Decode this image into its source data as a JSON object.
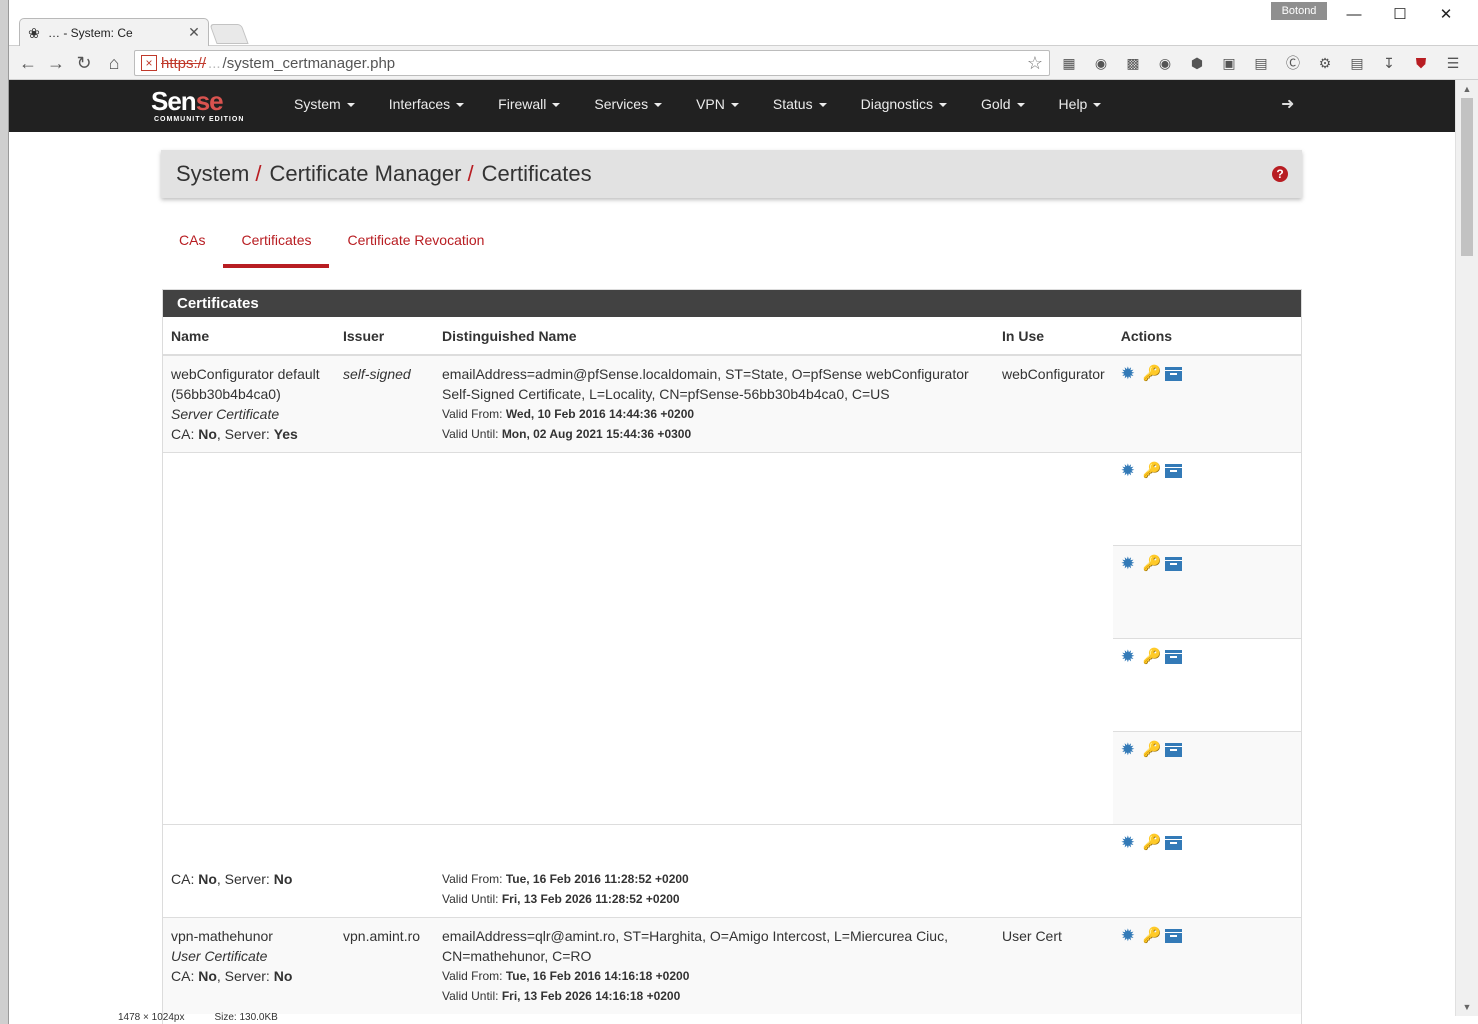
{
  "browser": {
    "tab_title": "… - System: Ce",
    "user_badge": "Botond",
    "url_scheme": "https://",
    "url_host": "...",
    "url_path": "/system_certmanager.php",
    "window_controls": [
      "—",
      "☐",
      "✕"
    ]
  },
  "nav": {
    "logo_text_a": "Sen",
    "logo_text_b": "se",
    "logo_sub": "COMMUNITY EDITION",
    "items": [
      "System",
      "Interfaces",
      "Firewall",
      "Services",
      "VPN",
      "Status",
      "Diagnostics",
      "Gold",
      "Help"
    ]
  },
  "breadcrumb": {
    "parts": [
      "System",
      "Certificate Manager",
      "Certificates"
    ],
    "separator": "/"
  },
  "tabs": [
    "CAs",
    "Certificates",
    "Certificate Revocation"
  ],
  "active_tab": "Certificates",
  "panel": {
    "title": "Certificates",
    "columns": [
      "Name",
      "Issuer",
      "Distinguished Name",
      "In Use",
      "Actions"
    ]
  },
  "rows": [
    {
      "name": "webConfigurator default (56bb30b4b4ca0)",
      "type": "Server Certificate",
      "ca_label": "CA:",
      "ca": "No",
      "server_label": ", Server:",
      "server": "Yes",
      "issuer": "self-signed",
      "dn": "emailAddress=admin@pfSense.localdomain, ST=State, O=pfSense webConfigurator Self-Signed Certificate, L=Locality, CN=pfSense-56bb30b4b4ca0, C=US",
      "valid_from_label": "Valid From:",
      "valid_from": "Wed, 10 Feb 2016 14:44:36 +0200",
      "valid_until_label": "Valid Until:",
      "valid_until": "Mon, 02 Aug 2021 15:44:36 +0300",
      "in_use": "webConfigurator"
    },
    {
      "ca_label": "CA:",
      "ca": "No",
      "server_label": ", Server:",
      "server": "No",
      "valid_from_label": "Valid From:",
      "valid_from": "Tue, 16 Feb 2016 11:28:52 +0200",
      "valid_until_label": "Valid Until:",
      "valid_until": "Fri, 13 Feb 2026 11:28:52 +0200"
    },
    {
      "name": "vpn-mathehunor",
      "type": "User Certificate",
      "ca_label": "CA:",
      "ca": "No",
      "server_label": ", Server:",
      "server": "No",
      "issuer": "vpn.amint.ro",
      "dn": "emailAddress=qlr@amint.ro, ST=Harghita, O=Amigo Intercost, L=Miercurea Ciuc, CN=mathehunor, C=RO",
      "valid_from_label": "Valid From:",
      "valid_from": "Tue, 16 Feb 2016 14:16:18 +0200",
      "valid_until_label": "Valid Until:",
      "valid_until": "Fri, 13 Feb 2026 14:16:18 +0200",
      "in_use": "User Cert"
    }
  ],
  "status": {
    "dimensions": "1478 × 1024px",
    "size": "Size: 130.0KB"
  },
  "colors": {
    "accent": "#b81d22",
    "nav_bg": "#212121",
    "panel_header": "#424242",
    "action_icon": "#337ab7"
  }
}
